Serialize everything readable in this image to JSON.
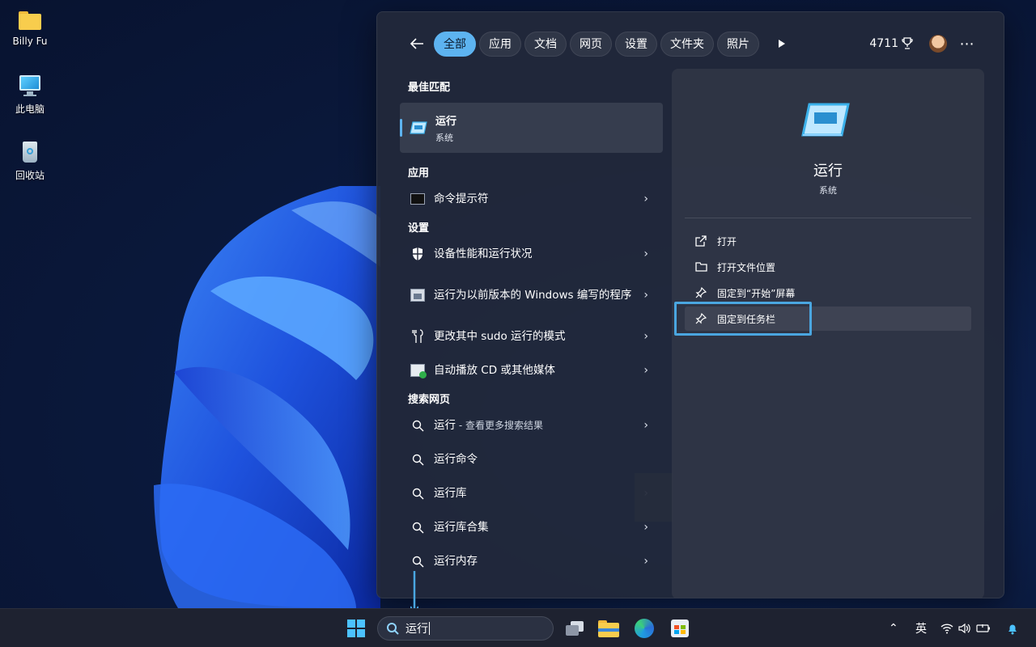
{
  "desktop": {
    "icons": [
      {
        "label": "Billy Fu",
        "icon": "folder-icon"
      },
      {
        "label": "此电脑",
        "icon": "monitor-icon"
      },
      {
        "label": "回收站",
        "icon": "recycle-bin-icon"
      }
    ]
  },
  "search_panel": {
    "filters": [
      "全部",
      "应用",
      "文档",
      "网页",
      "设置",
      "文件夹",
      "照片"
    ],
    "active_filter": "全部",
    "points": "4711",
    "best_match_header": "最佳匹配",
    "best_match": {
      "title": "运行",
      "subtitle": "系统"
    },
    "apps_header": "应用",
    "apps": [
      {
        "label": "命令提示符"
      }
    ],
    "settings_header": "设置",
    "settings": [
      {
        "label": "设备性能和运行状况"
      },
      {
        "label": "运行为以前版本的 Windows 编写的程序"
      },
      {
        "label": "更改其中 sudo 运行的模式"
      },
      {
        "label": "自动播放 CD 或其他媒体"
      }
    ],
    "web_header": "搜索网页",
    "web": [
      {
        "label": "运行",
        "suffix": " - 查看更多搜索结果"
      },
      {
        "label": "运行命令"
      },
      {
        "label": "运行库"
      },
      {
        "label": "运行库合集"
      },
      {
        "label": "运行内存"
      }
    ],
    "preview": {
      "title": "运行",
      "subtitle": "系统",
      "actions": [
        "打开",
        "打开文件位置",
        "固定到“开始”屏幕",
        "固定到任务栏"
      ]
    }
  },
  "taskbar": {
    "search_value": "运行",
    "ime_label": "英",
    "accent_color": "#5db3f0",
    "highlight_color": "#4aa6e0"
  }
}
